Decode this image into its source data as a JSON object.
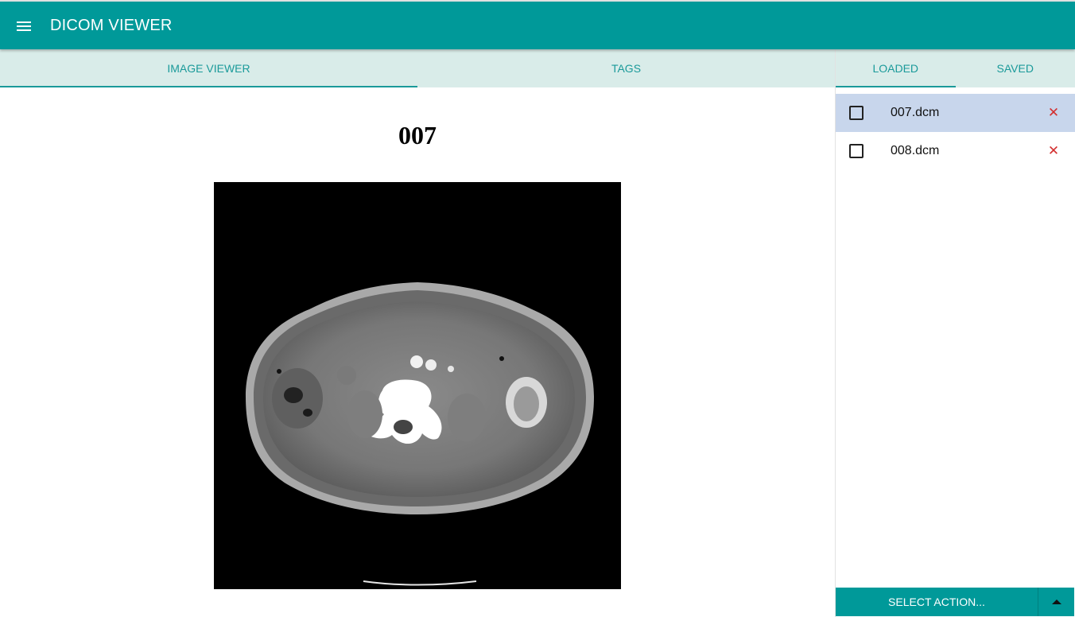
{
  "app": {
    "title": "DICOM VIEWER"
  },
  "main_tabs": [
    {
      "label": "IMAGE VIEWER",
      "active": true
    },
    {
      "label": "TAGS",
      "active": false
    }
  ],
  "viewer": {
    "image_title": "007"
  },
  "side_tabs": [
    {
      "label": "LOADED",
      "active": true
    },
    {
      "label": "SAVED",
      "active": false
    }
  ],
  "files": [
    {
      "name": "007.dcm",
      "selected": true,
      "checked": false,
      "remove_symbol": "✕"
    },
    {
      "name": "008.dcm",
      "selected": false,
      "checked": false,
      "remove_symbol": "✕"
    }
  ],
  "actions": {
    "select_label": "SELECT ACTION..."
  },
  "colors": {
    "primary": "#009999",
    "tab_background": "#d9ece9",
    "tab_text": "#1a9a9a",
    "selected_row": "#c8d6ec",
    "remove_icon": "#d32f2f"
  },
  "icons": {
    "menu": "menu-icon",
    "remove": "close-icon",
    "dropdown": "caret-up-icon"
  }
}
